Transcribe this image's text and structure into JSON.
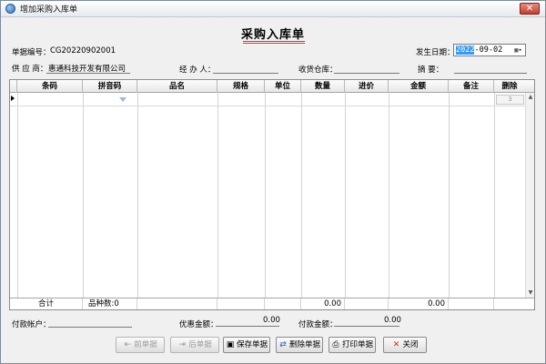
{
  "window": {
    "title": "增加采购入库单"
  },
  "form": {
    "title": "采购入库单"
  },
  "fields": {
    "doc_no_label": "单据编号：",
    "doc_no_value": "CG20220902001",
    "date_label": "发生日期：",
    "date_year": "2022",
    "date_rest": "-09-02",
    "supplier_label": "供  应  商：",
    "supplier_value": "惠通科技开发有限公司",
    "handler_label": "经  办  人：",
    "warehouse_label": "收货仓库：",
    "summary_label": "摘      要："
  },
  "grid": {
    "columns": [
      "条码",
      "拼音码",
      "品名",
      "规格",
      "单位",
      "数量",
      "进价",
      "金额",
      "备注",
      "删除"
    ],
    "delete_placeholder": "3",
    "footer": {
      "total_label": "合计",
      "kinds_label": "品种数:0",
      "qty_total": "0.00",
      "amount_total": "0.00"
    }
  },
  "payment": {
    "account_label": "付款帐户：",
    "discount_label": "优惠金额：",
    "discount_value": "0.00",
    "paid_label": "付款金额：",
    "paid_value": "0.00"
  },
  "buttons": {
    "prev": "前单据",
    "next": "后单据",
    "save": "保存单据",
    "delete": "删除单据",
    "print": "打印单据",
    "close": "关闭"
  },
  "colors": {
    "accent_underline": "#e03c31",
    "selection": "#3399ff"
  }
}
